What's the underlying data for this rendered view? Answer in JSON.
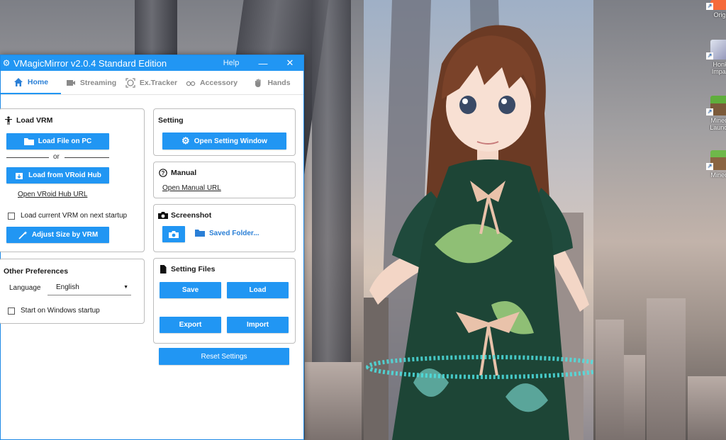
{
  "window": {
    "title": "VMagicMirror v2.0.4 Standard Edition",
    "help": "Help",
    "minimize": "—",
    "close": "✕"
  },
  "tabs": [
    {
      "label": "Home",
      "icon": "home-icon"
    },
    {
      "label": "Streaming",
      "icon": "video-camera-icon"
    },
    {
      "label": "Ex.Tracker",
      "icon": "face-tracker-icon"
    },
    {
      "label": "Accessory",
      "icon": "glasses-icon"
    },
    {
      "label": "Hands",
      "icon": "hand-icon"
    }
  ],
  "load_vrm": {
    "title": "Load VRM",
    "load_file_button": "Load File on PC",
    "or_text": "or",
    "vroid_button": "Load from VRoid Hub",
    "vroid_url_link": "Open VRoid Hub URL",
    "load_current_checkbox": "Load current VRM on next startup",
    "adjust_size_button": "Adjust Size by VRM"
  },
  "preferences": {
    "title": "Other Preferences",
    "language_label": "Language",
    "language_value": "English",
    "startup_checkbox": "Start on Windows startup"
  },
  "setting": {
    "title": "Setting",
    "open_button": "Open Setting Window"
  },
  "manual": {
    "title": "Manual",
    "link": "Open Manual URL"
  },
  "screenshot": {
    "title": "Screenshot",
    "saved_folder_button": "Saved Folder..."
  },
  "setting_files": {
    "title": "Setting Files",
    "save_button": "Save",
    "load_button": "Load",
    "export_button": "Export",
    "import_button": "Import"
  },
  "reset_button": "Reset Settings",
  "desktop_icons": [
    {
      "label": "Origi"
    },
    {
      "label": "Honk Impac"
    },
    {
      "label": "Minecr Launch"
    },
    {
      "label": "Minecr"
    }
  ],
  "colors": {
    "accent": "#2196f3",
    "titlebar": "#2196f3"
  }
}
